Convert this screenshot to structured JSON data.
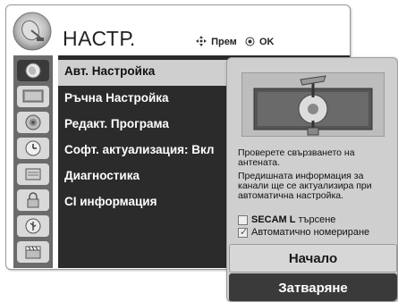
{
  "menu": {
    "title": "НАСТР.",
    "hint_move": "Прем",
    "hint_ok": "OK"
  },
  "sidebar": {
    "icons": [
      "satellite-dish-icon",
      "tv-screen-icon",
      "speaker-icon",
      "clock-icon",
      "lock-icon",
      "input-icon",
      "usb-icon",
      "clapperboard-icon"
    ]
  },
  "items": [
    {
      "label": "Авт. Настройка"
    },
    {
      "label": "Ръчна Настройка"
    },
    {
      "label": "Редакт. Програма"
    },
    {
      "label": "Софт. актуализация: Вкл"
    },
    {
      "label": "Диагностика"
    },
    {
      "label": "CI информация"
    }
  ],
  "popup": {
    "text1": "Проверете свързването на антената.",
    "text2": "Предишната информация за канали ще се актуализира при  автоматична настройка.",
    "secam_strong": "SECAM L",
    "secam_rest": "търсене",
    "auto_number": "Автоматично номериране",
    "start_label": "Начало",
    "close_label": "Затваряне"
  },
  "colors": {
    "dark": "#2b2b2b",
    "selected": "#cfcfcf",
    "sidebar": "#6b6b6b"
  }
}
